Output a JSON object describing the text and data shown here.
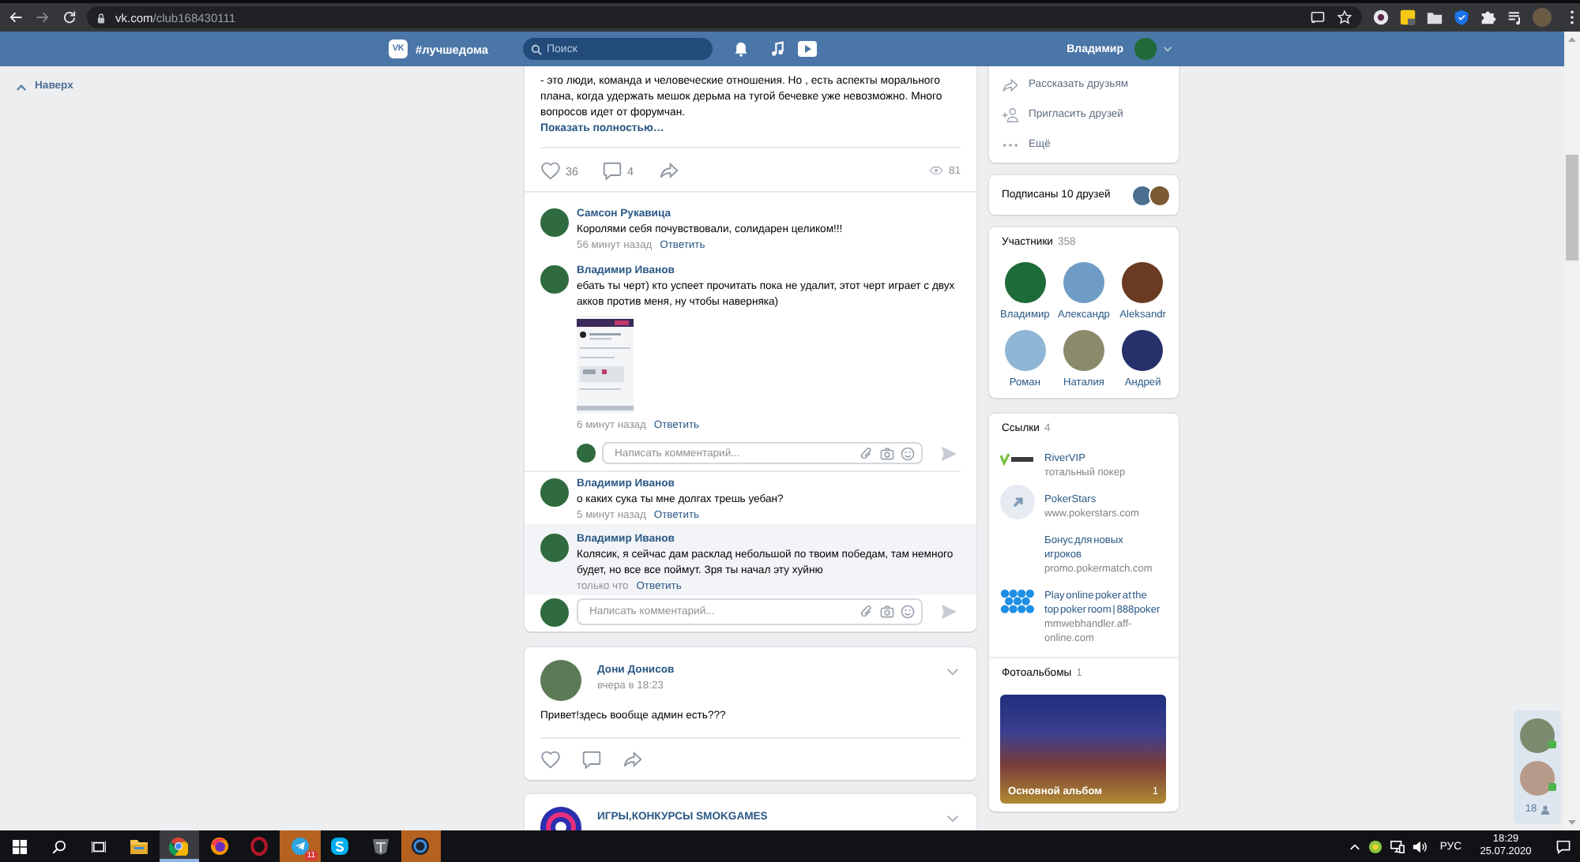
{
  "browser": {
    "url_host": "vk.com",
    "url_path": "/club168430111"
  },
  "header": {
    "logo": "VK",
    "title": "#лучшедома",
    "search": {
      "placeholder": "Поиск"
    },
    "user_name": "Владимир"
  },
  "back_to_top": {
    "label": "Наверх"
  },
  "post": {
    "text": "- это люди, команда и человеческие отношения. Но , есть аспекты морального плана, когда удержать мешок дерьма на тугой бечевке уже невозможно. Много вопросов идет от форумчан.",
    "show_more": "Показать полностью…",
    "likes": "36",
    "liked": false,
    "comments": "4",
    "views": "81"
  },
  "comments": [
    {
      "kind": "comment",
      "author": "Самсон Рукавица",
      "text": "Королями себя почувствовали, солидарен целиком!!!",
      "time": "56 минут назад",
      "reply": "Ответить"
    },
    {
      "kind": "comment",
      "author": "Владимир Иванов",
      "text": "ебать ты черт) кто успеет прочитать пока не удалит, этот черт играет с двух акков против меня, ну чтобы наверняка)",
      "has_image": true,
      "time": "6 минут назад",
      "reply": "Ответить"
    },
    {
      "kind": "reply_box",
      "placeholder": "Написать комментарий..."
    },
    {
      "kind": "comment",
      "author": "Владимир Иванов",
      "text": "о каких сука ты мне долгах трешь уебан?",
      "time": "5 минут назад",
      "reply": "Ответить"
    },
    {
      "kind": "comment",
      "author": "Владимир Иванов",
      "text": "Колясик, я сейчас дам расклад небольшой по твоим победам, там немного будет, но все все поймут. Зря ты начал эту хуйню",
      "time": "только что",
      "reply": "Ответить",
      "highlighted": true
    }
  ],
  "comment_box": {
    "placeholder": "Написать комментарий..."
  },
  "feed": [
    {
      "author": "Дони Донисов",
      "time": "вчера в 18:23",
      "text": "Привет!здесь вообще админ есть???"
    },
    {
      "author": "ИГРЫ,КОНКУРСЫ SMOKGAMES"
    }
  ],
  "actions": [
    {
      "kind": "share",
      "label": "Рассказать друзьям"
    },
    {
      "kind": "invite",
      "label": "Пригласить друзей"
    },
    {
      "kind": "more",
      "label": "Ещё"
    }
  ],
  "friends": {
    "label": "Подписаны 10 друзей"
  },
  "members": {
    "title": "Участники",
    "count": "358",
    "people": [
      {
        "name": "Владимир"
      },
      {
        "name": "Александр"
      },
      {
        "name": "Aleksandr"
      },
      {
        "name": "Роман"
      },
      {
        "name": "Наталия"
      },
      {
        "name": "Андрей"
      }
    ]
  },
  "links": {
    "title": "Ссылки",
    "count": "4",
    "items": [
      {
        "kind": "logo",
        "title": "RiverVIP",
        "subtitle": "тотальный покер"
      },
      {
        "kind": "arrow",
        "title": "PokerStars",
        "subtitle": "www.pokerstars.com"
      },
      {
        "kind": "none",
        "title": "Бонус для новых игроков",
        "subtitle": "promo.pokermatch.com"
      },
      {
        "kind": "dots",
        "title": "Play online poker at the top poker room | 888poker",
        "subtitle": "mmwebhandler.aff-online.com"
      }
    ]
  },
  "albums": {
    "title": "Фотоальбомы",
    "count": "1",
    "items": [
      {
        "name": "Основной альбом",
        "count": "1"
      }
    ]
  },
  "chat": {
    "count": "18",
    "contacts": [
      {
        "online": true
      },
      {
        "online": true
      }
    ]
  },
  "taskbar": {
    "apps": [
      {
        "kind": "explorer",
        "active": false,
        "flashing": false
      },
      {
        "kind": "chrome",
        "active": true,
        "flashing": false
      },
      {
        "kind": "firefox",
        "active": false,
        "flashing": false
      },
      {
        "kind": "opera",
        "active": false,
        "flashing": false
      },
      {
        "kind": "telegram",
        "active": false,
        "flashing": true,
        "badge": "11"
      },
      {
        "kind": "skype",
        "active": false,
        "flashing": false
      },
      {
        "kind": "emblem",
        "active": false,
        "flashing": false
      },
      {
        "kind": "round",
        "active": false,
        "flashing": true
      }
    ],
    "tray": {
      "language": "РУС",
      "time": "18:29",
      "date": "25.07.2020"
    }
  }
}
